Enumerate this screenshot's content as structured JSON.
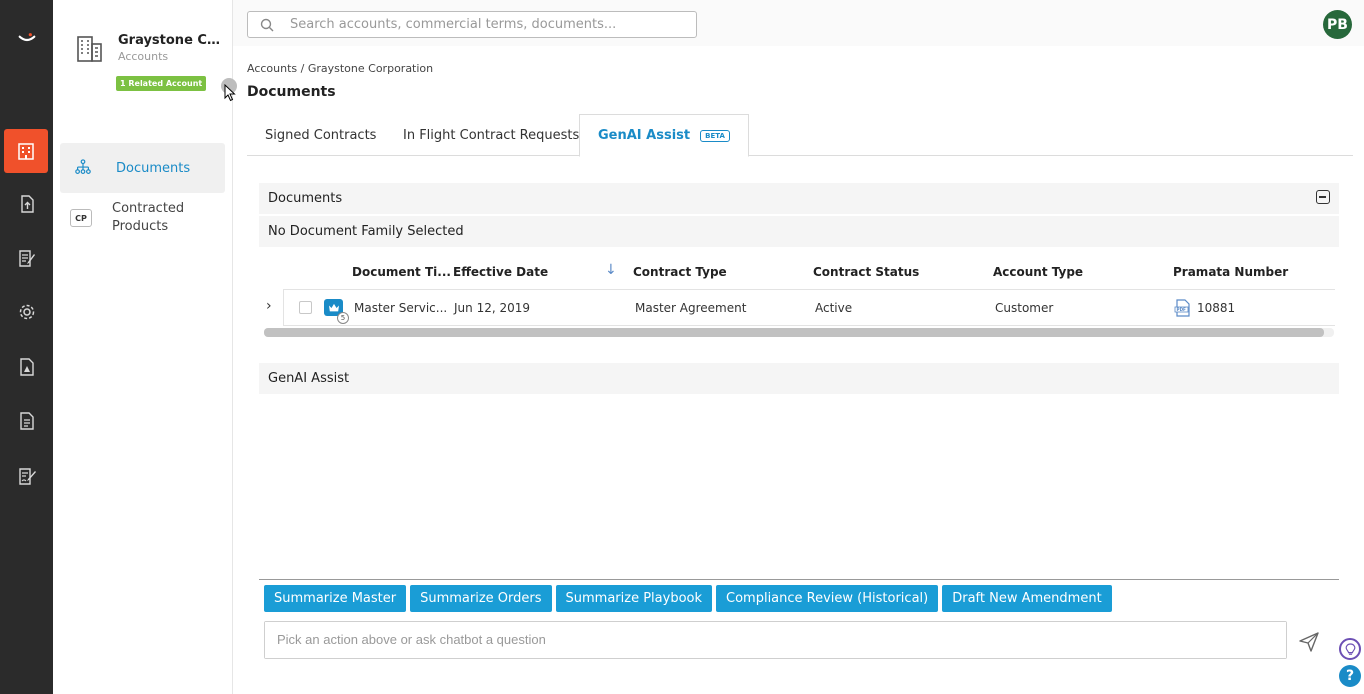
{
  "rail": {
    "items": [
      {
        "name": "accounts",
        "icon": "building-icon",
        "active": true
      },
      {
        "name": "upload",
        "icon": "file-upload-icon"
      },
      {
        "name": "contract-edit",
        "icon": "document-edit-icon"
      },
      {
        "name": "settings",
        "icon": "gear-icon"
      },
      {
        "name": "reports",
        "icon": "document-chart-icon"
      },
      {
        "name": "documents",
        "icon": "document-list-icon"
      },
      {
        "name": "sign",
        "icon": "document-sign-icon"
      }
    ],
    "colors": {
      "background": "#2b2b2b",
      "active": "#f0512b"
    }
  },
  "account": {
    "name": "Graystone Cor...",
    "subtitle": "Accounts",
    "related_badge": "1 Related Account",
    "badge_color": "#7cc142"
  },
  "side_nav": {
    "items": [
      {
        "label": "Documents",
        "icon": "sitemap-icon",
        "active": true
      },
      {
        "label_line1": "Contracted",
        "label_line2": "Products",
        "icon_text": "CP"
      }
    ]
  },
  "search": {
    "placeholder": "Search accounts, commercial terms, documents..."
  },
  "user": {
    "initials": "PB",
    "color": "#27683b"
  },
  "breadcrumb": "Accounts / Graystone Corporation",
  "page_title": "Documents",
  "tabs": [
    {
      "label": "Signed Contracts"
    },
    {
      "label": "In Flight Contract Requests"
    },
    {
      "label": "GenAI Assist",
      "badge": "BETA",
      "active": true
    }
  ],
  "documents_section": {
    "title": "Documents",
    "subtitle": "No Document Family Selected",
    "columns": [
      "Document Ti...",
      "Effective Date",
      "Contract Type",
      "Contract Status",
      "Account Type",
      "Pramata Number"
    ],
    "sort_indicator": "↓",
    "rows": [
      {
        "document_title": "Master Servic...",
        "effective_date": "Jun 12, 2019",
        "contract_type": "Master Agreement",
        "contract_status": "Active",
        "account_type": "Customer",
        "pramata_number": "10881",
        "badge": "5"
      }
    ]
  },
  "genai_section": {
    "title": "GenAI Assist",
    "actions": [
      "Summarize Master",
      "Summarize Orders",
      "Summarize Playbook",
      "Compliance Review (Historical)",
      "Draft New Amendment"
    ],
    "input_placeholder": "Pick an action above or ask chatbot a question"
  },
  "help": {
    "label": "?"
  },
  "accent_color": "#1a8bc7",
  "action_button_color": "#1a9dd6"
}
